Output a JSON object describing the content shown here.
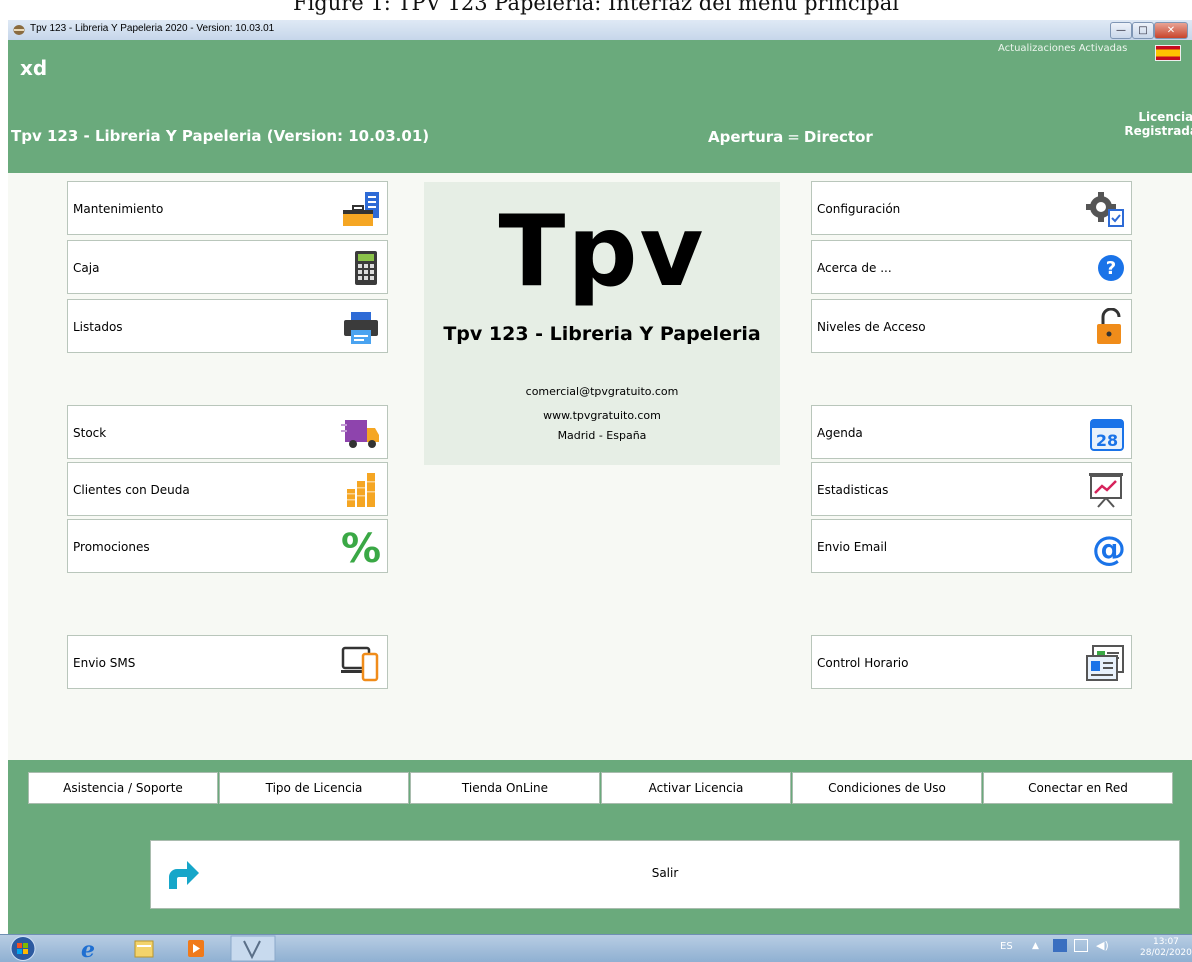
{
  "caption": "Figure 1: TPV 123 Papeleria: Interfaz del menu principal",
  "window": {
    "title": "Tpv 123 - Libreria Y Papeleria  2020 -  Version: 10.03.01",
    "controls": [
      "—",
      "□",
      "✕"
    ]
  },
  "header": {
    "app_name": "xd",
    "updates": "Actualizaciones Activadas",
    "license": "Licencia: Registrada",
    "title": "Tpv 123 - Libreria Y Papeleria (Version: 10.03.01)",
    "opening_label": "Apertura",
    "opening_eq": "=",
    "opening_value": "Director"
  },
  "left_menu": [
    {
      "label": "Mantenimiento",
      "icon": "toolbox-icon"
    },
    {
      "label": "Caja",
      "icon": "calculator-icon"
    },
    {
      "label": "Listados",
      "icon": "printer-icon"
    },
    {
      "label": "Stock",
      "icon": "truck-icon"
    },
    {
      "label": "Clientes con Deuda",
      "icon": "coins-icon"
    },
    {
      "label": "Promociones",
      "icon": "percent-icon"
    },
    {
      "label": "Envio SMS",
      "icon": "devices-icon"
    }
  ],
  "right_menu": [
    {
      "label": "Configuración",
      "icon": "gear-icon"
    },
    {
      "label": "Acerca de ...",
      "icon": "help-icon"
    },
    {
      "label": "Niveles de Acceso",
      "icon": "padlock-icon"
    },
    {
      "label": "Agenda",
      "icon": "calendar-icon",
      "text": "28"
    },
    {
      "label": "Estadisticas",
      "icon": "chart-board-icon"
    },
    {
      "label": "Envio Email",
      "icon": "at-sign-icon",
      "text": "@"
    },
    {
      "label": "Control Horario",
      "icon": "id-card-icon"
    }
  ],
  "center": {
    "logo": "Tpv",
    "product": "Tpv 123 - Libreria Y Papeleria",
    "email": "comercial@tpvgratuito.com",
    "web": "www.tpvgratuito.com",
    "location": "Madrid - España"
  },
  "footer": {
    "buttons": [
      "Asistencia / Soporte",
      "Tipo de Licencia",
      "Tienda OnLine",
      "Activar Licencia",
      "Condiciones de Uso",
      "Conectar en Red"
    ],
    "exit_label": "Salir"
  },
  "taskbar": {
    "lang": "ES",
    "time": "13:07",
    "date": "28/02/2020"
  },
  "colors": {
    "green": "#6aaa7c",
    "accent_blue": "#1a73e8"
  }
}
